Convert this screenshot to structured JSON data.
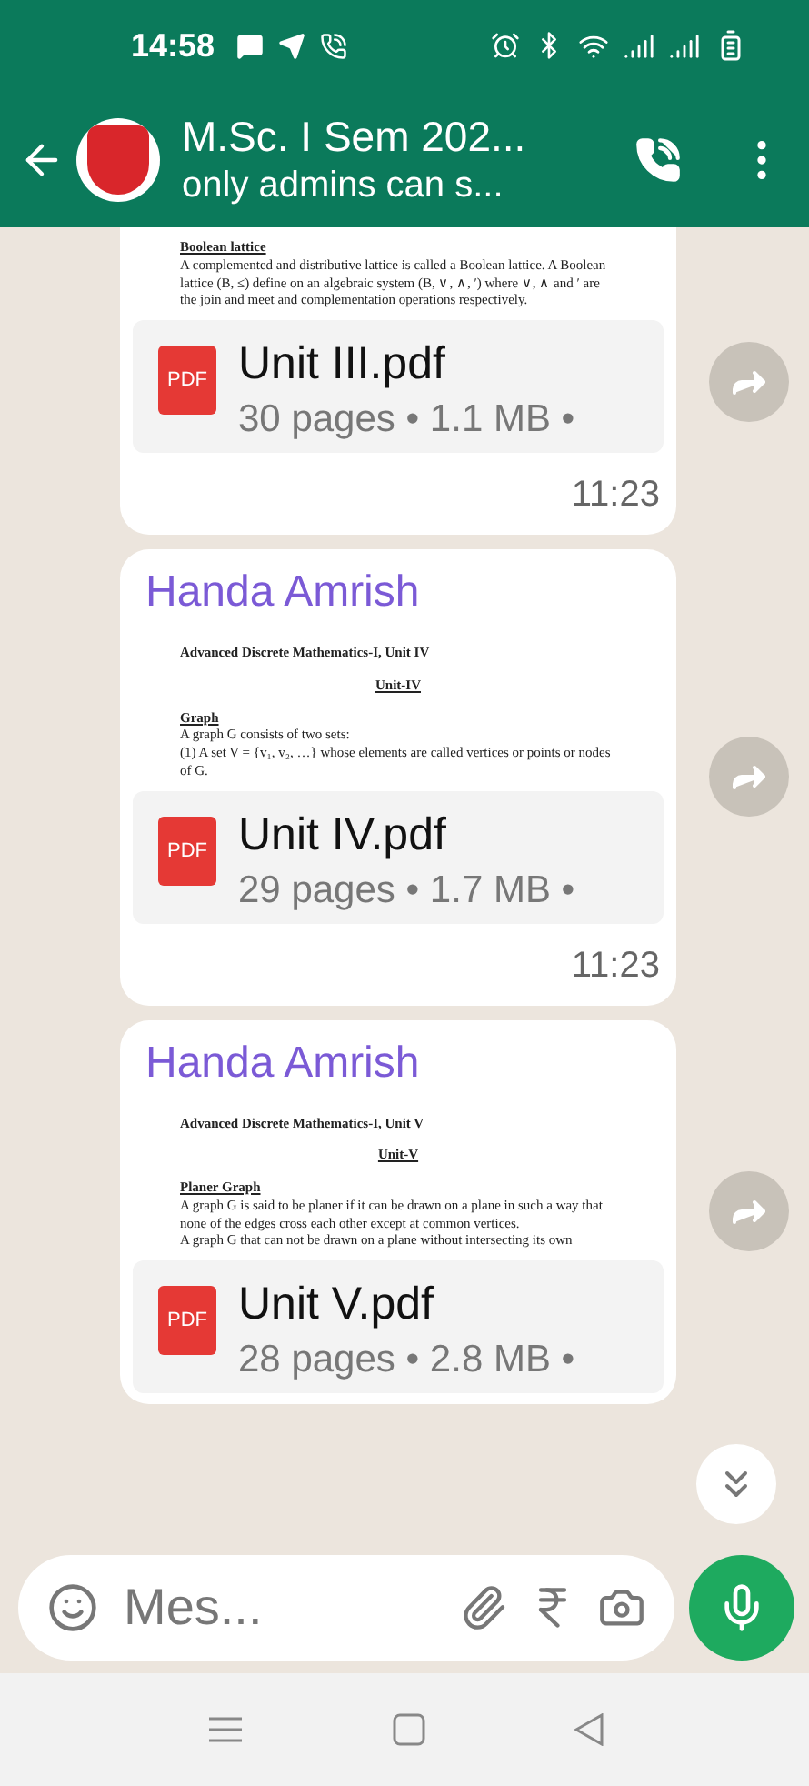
{
  "status_bar": {
    "time": "14:58"
  },
  "header": {
    "title": "M.Sc. I Sem 202...",
    "subtitle": "only admins can s..."
  },
  "messages": [
    {
      "preview": [
        {
          "kind": "heading",
          "text": "Boolean lattice"
        },
        {
          "kind": "body",
          "text": "A complemented and distributive lattice is called a Boolean lattice. A Boolean lattice (B, ≤) define on an algebraic system (B, ∨, ∧, ′) where ∨, ∧ and ′ are the join and meet and complementation operations respectively."
        }
      ],
      "file_icon_label": "PDF",
      "file_name": "Unit III.pdf",
      "file_info": "30 pages • 1.1 MB •",
      "time": "11:23"
    },
    {
      "sender": "Handa Amrish",
      "preview": [
        {
          "kind": "title",
          "text": "Advanced Discrete Mathematics-I, Unit IV"
        },
        {
          "kind": "center",
          "text": "Unit-IV"
        },
        {
          "kind": "heading",
          "text": "Graph"
        },
        {
          "kind": "body",
          "text": "A graph G consists of two sets:"
        },
        {
          "kind": "body",
          "text": "(1) A set V = {v₁, v₂, …} whose elements are called vertices or points or nodes of G."
        }
      ],
      "file_icon_label": "PDF",
      "file_name": "Unit IV.pdf",
      "file_info": "29 pages • 1.7 MB •",
      "time": "11:23"
    },
    {
      "sender": "Handa Amrish",
      "preview": [
        {
          "kind": "title",
          "text": "Advanced Discrete Mathematics-I, Unit V"
        },
        {
          "kind": "center",
          "text": "Unit-V"
        },
        {
          "kind": "heading",
          "text": "Planer Graph"
        },
        {
          "kind": "body",
          "text": "A graph G is said to be planer if it can be drawn on a plane in such a way that none of the edges cross each other except at common vertices."
        },
        {
          "kind": "body",
          "text": "A graph G that can not be drawn on a plane without intersecting its own"
        }
      ],
      "file_icon_label": "PDF",
      "file_name": "Unit V.pdf",
      "file_info": "28 pages • 2.8 MB •"
    }
  ],
  "composer": {
    "placeholder": "Mes..."
  }
}
